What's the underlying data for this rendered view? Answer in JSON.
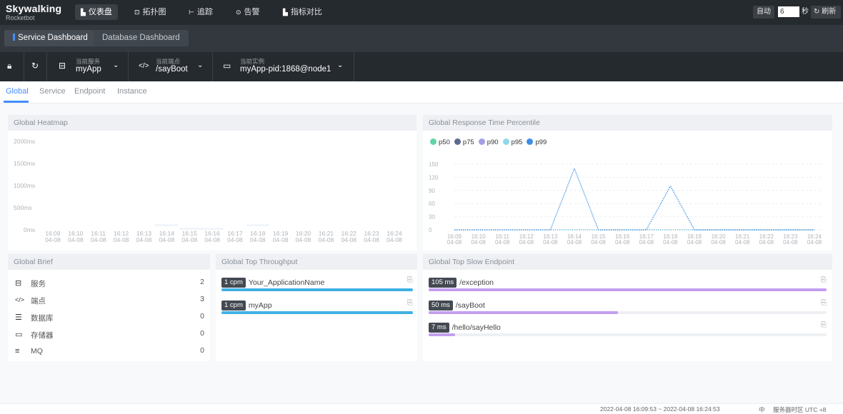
{
  "brand": {
    "name": "Skywalking",
    "sub": "Rocketbot"
  },
  "nav": [
    {
      "label": "仪表盘",
      "icon": "bar-chart-icon",
      "active": true
    },
    {
      "label": "拓扑图",
      "icon": "topology-icon",
      "active": false
    },
    {
      "label": "追踪",
      "icon": "trace-icon",
      "active": false
    },
    {
      "label": "告警",
      "icon": "alarm-icon",
      "active": false
    },
    {
      "label": "指标对比",
      "icon": "compare-icon",
      "active": false
    }
  ],
  "toolbar": {
    "auto": "自动",
    "interval": "6",
    "seconds": "秒",
    "refresh": "刷新"
  },
  "dashboards": [
    "Service Dashboard",
    "Database Dashboard"
  ],
  "selectors": {
    "service": {
      "label": "当前服务",
      "value": "myApp"
    },
    "endpoint": {
      "label": "当前端点",
      "value": "/sayBoot"
    },
    "instance": {
      "label": "当前实例",
      "value": "myApp-pid:1868@node1"
    }
  },
  "tabs": [
    "Global",
    "Service",
    "Endpoint",
    "Instance"
  ],
  "heatmap": {
    "title": "Global Heatmap",
    "y_ticks": [
      "2000ms",
      "1500ms",
      "1000ms",
      "500ms",
      "0ms"
    ],
    "x_ticks": [
      "16:09",
      "16:10",
      "16:11",
      "16:12",
      "16:13",
      "16:14",
      "16:15",
      "16:16",
      "16:17",
      "16:18",
      "16:19",
      "16:20",
      "16:21",
      "16:22",
      "16:23",
      "16:24"
    ],
    "x_date": "04-08"
  },
  "percentile": {
    "title": "Global Response Time Percentile",
    "legend": [
      {
        "name": "p50",
        "color": "#5fd4a5"
      },
      {
        "name": "p75",
        "color": "#5c6b8f"
      },
      {
        "name": "p90",
        "color": "#a59ee6"
      },
      {
        "name": "p95",
        "color": "#8fd9e8"
      },
      {
        "name": "p99",
        "color": "#3e8ee8"
      }
    ],
    "y_ticks": [
      "150",
      "120",
      "90",
      "60",
      "30",
      "0"
    ]
  },
  "chart_data": {
    "type": "line",
    "title": "Global Response Time Percentile",
    "x": [
      "16:09",
      "16:10",
      "16:11",
      "16:12",
      "16:13",
      "16:14",
      "16:15",
      "16:16",
      "16:17",
      "16:18",
      "16:19",
      "16:20",
      "16:21",
      "16:22",
      "16:23",
      "16:24"
    ],
    "x_date": "04-08",
    "ylim": [
      0,
      150
    ],
    "grid": true,
    "legend_position": "top-left",
    "series": [
      {
        "name": "p50",
        "values": [
          0,
          0,
          0,
          0,
          0,
          0,
          0,
          0,
          0,
          0,
          0,
          0,
          0,
          0,
          0,
          0
        ]
      },
      {
        "name": "p75",
        "values": [
          0,
          0,
          0,
          0,
          0,
          0,
          0,
          0,
          0,
          0,
          0,
          0,
          0,
          0,
          0,
          0
        ]
      },
      {
        "name": "p90",
        "values": [
          0,
          0,
          0,
          0,
          0,
          0,
          0,
          0,
          0,
          0,
          0,
          0,
          0,
          0,
          0,
          0
        ]
      },
      {
        "name": "p95",
        "values": [
          0,
          0,
          0,
          0,
          0,
          0,
          0,
          0,
          0,
          0,
          0,
          0,
          0,
          0,
          0,
          0
        ]
      },
      {
        "name": "p99",
        "values": [
          0,
          0,
          0,
          0,
          0,
          140,
          0,
          0,
          0,
          100,
          0,
          0,
          0,
          0,
          0,
          0
        ]
      }
    ]
  },
  "brief": {
    "title": "Global Brief",
    "rows": [
      {
        "icon": "server-icon",
        "label": "服务",
        "value": "2"
      },
      {
        "icon": "code-icon",
        "label": "端点",
        "value": "3"
      },
      {
        "icon": "database-icon",
        "label": "数据库",
        "value": "0"
      },
      {
        "icon": "storage-icon",
        "label": "存储器",
        "value": "0"
      },
      {
        "icon": "mq-icon",
        "label": "MQ",
        "value": "0"
      }
    ]
  },
  "throughput": {
    "title": "Global Top Throughput",
    "color": "#3fb1e3",
    "rows": [
      {
        "tag": "1 cpm",
        "name": "Your_ApplicationName",
        "fraction": 1.0
      },
      {
        "tag": "1 cpm",
        "name": "myApp",
        "fraction": 1.0
      }
    ]
  },
  "slow": {
    "title": "Global Top Slow Endpoint",
    "color": "#c39ef0",
    "rows": [
      {
        "tag": "105 ms",
        "name": "/exception",
        "fraction": 1.0
      },
      {
        "tag": "50 ms",
        "name": "/sayBoot",
        "fraction": 0.476
      },
      {
        "tag": "7 ms",
        "name": "/hello/sayHello",
        "fraction": 0.067
      }
    ]
  },
  "footer": {
    "range": "2022-04-08 16:09:53 ~ 2022-04-08 16:24:53",
    "lang": "中",
    "tz": "服务器时区 UTC +8"
  }
}
